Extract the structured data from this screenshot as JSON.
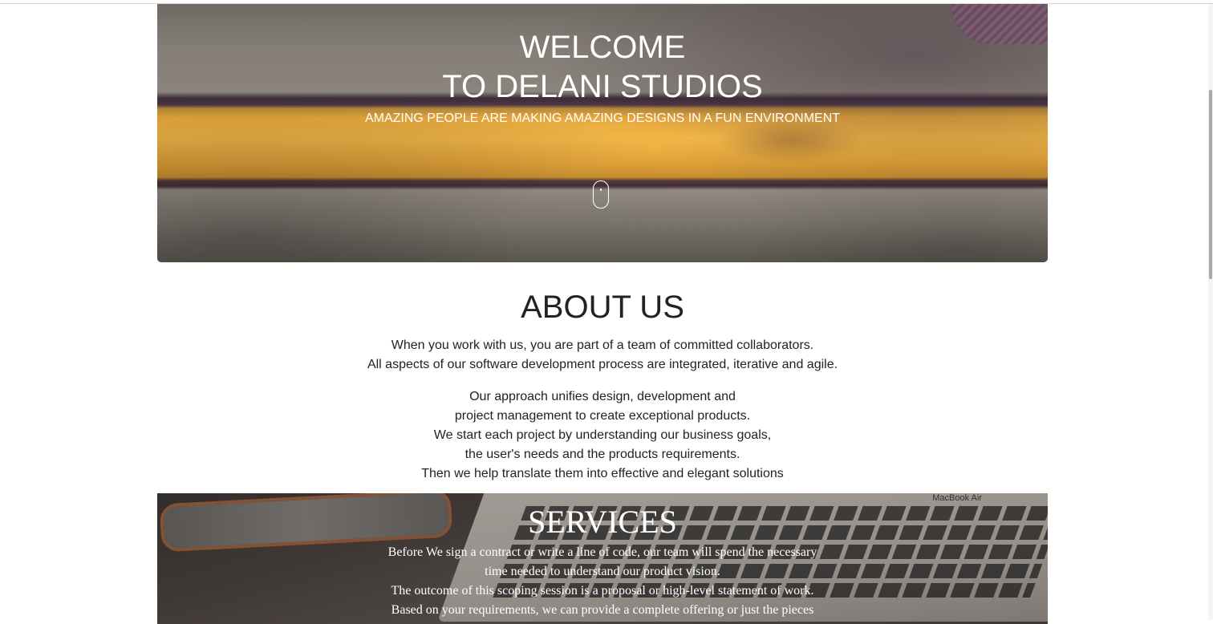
{
  "hero": {
    "title_line1": "WELCOME",
    "title_line2": "TO DELANI STUDIOS",
    "subtitle": "AMAZING PEOPLE ARE MAKING AMAZING DESIGNS IN A FUN ENVIRONMENT",
    "scroll_icon": "mouse-scroll-icon"
  },
  "about": {
    "title": "ABOUT US",
    "paragraph1": [
      "When you work with us, you are part of a team of committed collaborators.",
      "All aspects of our software development process are integrated, iterative and agile."
    ],
    "paragraph2": [
      "Our approach unifies design, development and",
      "project management to create exceptional products.",
      "We start each project by understanding our business goals,",
      "the user's needs and the products requirements.",
      "Then we help translate them into effective and elegant solutions"
    ]
  },
  "services": {
    "title": "SERVICES",
    "background_label": "MacBook Air",
    "lines": [
      "Before We sign a contract or write a line of code, our team will spend the necessary",
      "time needed to understand our product vision.",
      "The outcome of this scoping session is a proposal or high-level statement of work.",
      "Based on your requirements, we can provide a complete offering or just the pieces"
    ]
  },
  "colors": {
    "accent_yellow": "#f0b648",
    "text_dark": "#222222",
    "text_light": "#ffffff"
  }
}
